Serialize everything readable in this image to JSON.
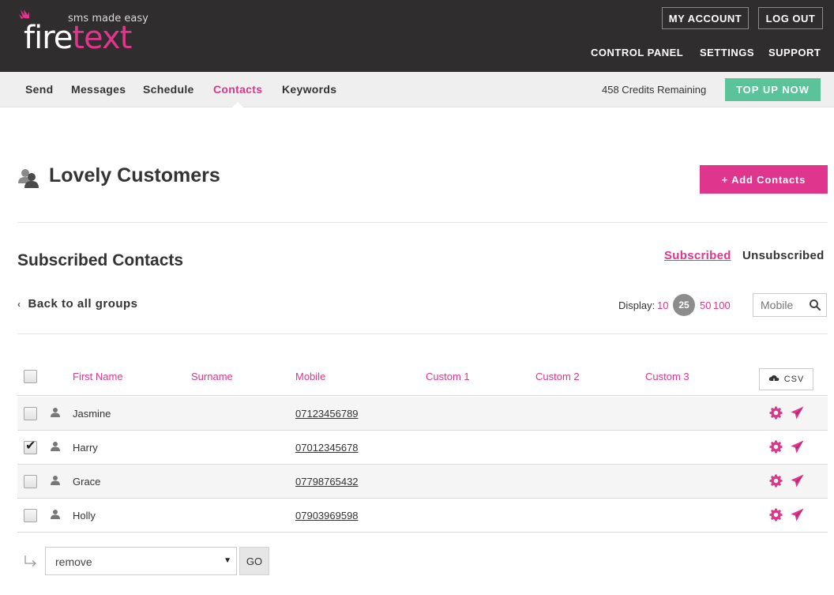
{
  "brand": {
    "tagline": "sms made easy",
    "name_part1": "fire",
    "name_part2": "text",
    "accent_color": "#e0358c",
    "header_bg": "#2f2d2e"
  },
  "header": {
    "my_account": "MY ACCOUNT",
    "log_out": "LOG OUT",
    "nav": [
      "CONTROL PANEL",
      "SETTINGS",
      "SUPPORT"
    ]
  },
  "subnav": {
    "items": [
      "Send",
      "Messages",
      "Schedule",
      "Contacts",
      "Keywords"
    ],
    "active": "Contacts",
    "credits": "458 Credits Remaining",
    "top_up": "TOP UP NOW",
    "top_up_color": "#5bc39a"
  },
  "group": {
    "icon": "group-users-icon",
    "title": "Lovely Customers",
    "add_button": "+ Add Contacts"
  },
  "section": {
    "title": "Subscribed Contacts",
    "tabs": [
      "Subscribed",
      "Unsubscribed"
    ],
    "active_tab": "Subscribed",
    "back_link": "Back to all groups"
  },
  "display": {
    "label": "Display:",
    "options": [
      "10",
      "25",
      "50",
      "100"
    ],
    "selected": "25"
  },
  "search": {
    "placeholder": "Mobile",
    "value": ""
  },
  "table": {
    "columns": [
      "First Name",
      "Surname",
      "Mobile",
      "Custom 1",
      "Custom 2",
      "Custom 3"
    ],
    "csv_label": "CSV",
    "rows": [
      {
        "first_name": "Jasmine",
        "surname": "",
        "mobile": "07123456789",
        "checked": false
      },
      {
        "first_name": "Harry",
        "surname": "",
        "mobile": "07012345678",
        "checked": true
      },
      {
        "first_name": "Grace",
        "surname": "",
        "mobile": "07798765432",
        "checked": false
      },
      {
        "first_name": "Holly",
        "surname": "",
        "mobile": "07903969598",
        "checked": false
      }
    ]
  },
  "bulk": {
    "selected_action": "remove",
    "go_label": "GO"
  }
}
